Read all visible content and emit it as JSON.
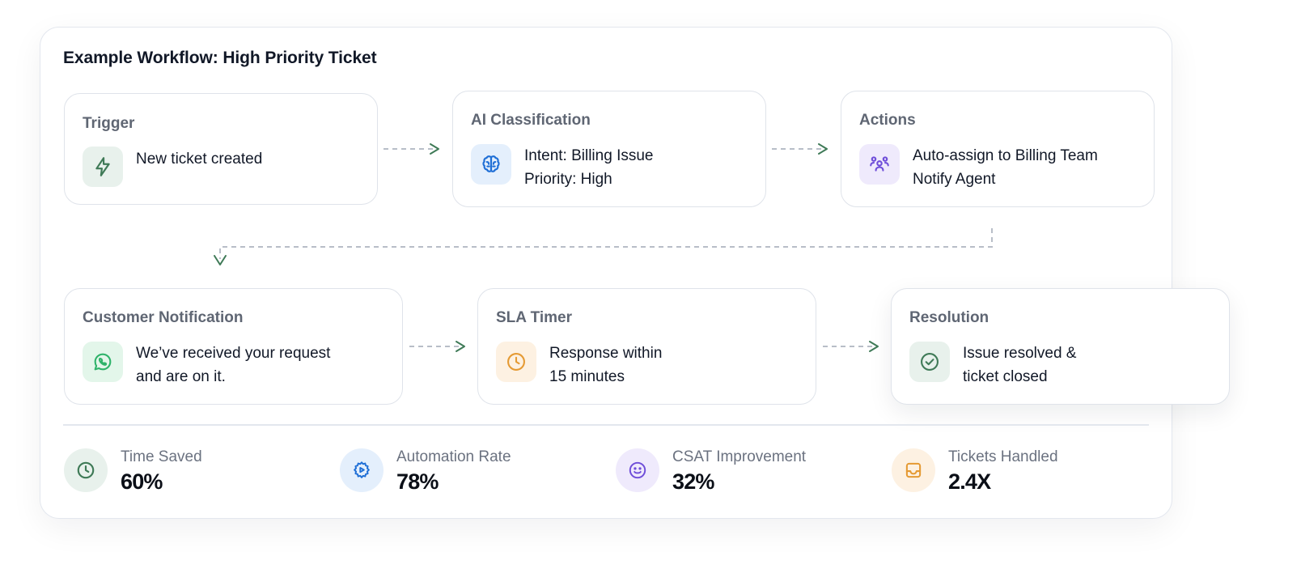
{
  "workflow": {
    "title": "Example Workflow: High Priority Ticket",
    "steps": [
      {
        "title": "Trigger",
        "icon": "lightning-icon",
        "lines": [
          "New ticket created"
        ]
      },
      {
        "title": "AI Classification",
        "icon": "brain-icon",
        "lines": [
          "Intent: Billing Issue",
          "Priority: High"
        ]
      },
      {
        "title": "Actions",
        "icon": "team-icon",
        "lines": [
          "Auto-assign to Billing Team",
          "Notify Agent"
        ]
      },
      {
        "title": "Customer Notification",
        "icon": "whatsapp-icon",
        "lines": [
          "We’ve received your request",
          "and are on it."
        ]
      },
      {
        "title": "SLA Timer",
        "icon": "clock-icon",
        "lines": [
          "Response within",
          "15 minutes"
        ]
      },
      {
        "title": "Resolution",
        "icon": "check-circle-icon",
        "lines": [
          "Issue resolved &",
          "ticket closed"
        ]
      }
    ]
  },
  "stats": [
    {
      "label": "Time Saved",
      "value": "60%",
      "icon": "clock-icon"
    },
    {
      "label": "Automation Rate",
      "value": "78%",
      "icon": "gear-play-icon"
    },
    {
      "label": "CSAT Improvement",
      "value": "32%",
      "icon": "smiley-icon"
    },
    {
      "label": "Tickets Handled",
      "value": "2.4X",
      "icon": "inbox-icon"
    }
  ],
  "colors": {
    "green": "#3f7a57",
    "green_bg": "#e8f1ec",
    "blue": "#1f6fd6",
    "blue_bg": "#e4effc",
    "purple": "#6f4ed9",
    "purple_bg": "#efeafc",
    "whatsapp": "#2fb36a",
    "whatsapp_bg": "#e3f6ea",
    "orange": "#e59a33",
    "orange_bg": "#fdf1e2",
    "connector": "#b8bec8",
    "arrow": "#3f7a57"
  }
}
